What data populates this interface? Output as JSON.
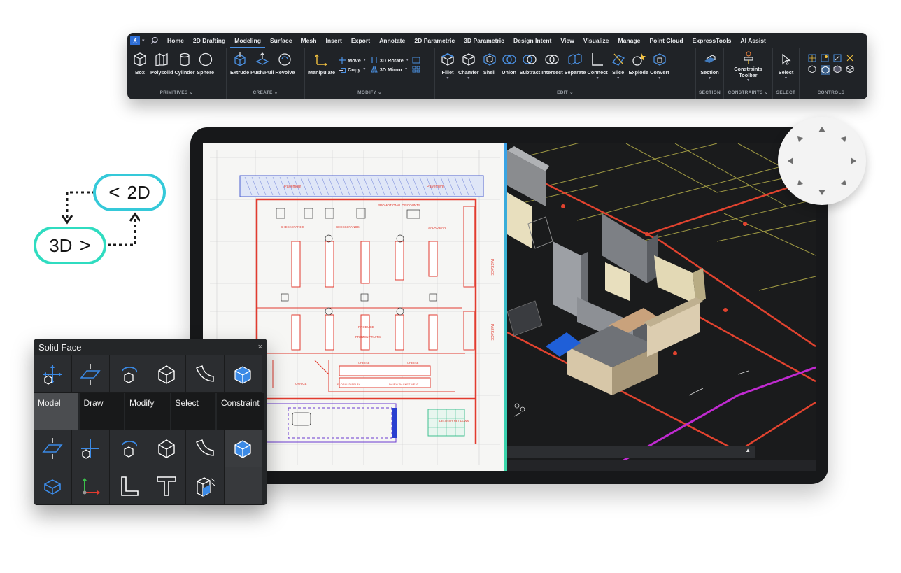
{
  "ribbon": {
    "tabs": [
      "Home",
      "2D Drafting",
      "Modeling",
      "Surface",
      "Mesh",
      "Insert",
      "Export",
      "Annotate",
      "2D Parametric",
      "3D Parametric",
      "Design Intent",
      "View",
      "Visualize",
      "Manage",
      "Point Cloud",
      "ExpressTools",
      "AI Assist"
    ],
    "active_tab": "Modeling",
    "primitives": {
      "tools": [
        "Box",
        "Polysolid",
        "Cylinder",
        "Sphere"
      ],
      "label": "PRIMITIVES ⌄"
    },
    "create": {
      "tools": [
        "Extrude",
        "Push/Pull",
        "Revolve"
      ],
      "label": "CREATE ⌄"
    },
    "modify": {
      "manipulate": "Manipulate",
      "move": "Move",
      "copy": "Copy",
      "rotate3d": "3D Rotate",
      "mirror3d": "3D Mirror",
      "label": "MODIFY ⌄"
    },
    "edit": {
      "tools": [
        "Fillet",
        "Chamfer",
        "Shell",
        "Union",
        "Subtract",
        "Intersect",
        "Separate",
        "Connect",
        "Slice",
        "Explode",
        "Convert"
      ],
      "label": "EDIT ⌄"
    },
    "section": {
      "tool": "Section",
      "label": "SECTION"
    },
    "constraints": {
      "tool_line1": "Constraints",
      "tool_line2": "Toolbar",
      "label": "CONSTRAINTS ⌄"
    },
    "select": {
      "tool": "Select",
      "label": "SELECT"
    },
    "controls": {
      "label": "CONTROLS"
    }
  },
  "switch": {
    "label_2d": "2D",
    "label_3d": "3D"
  },
  "floorplan": {
    "labels": [
      "Pavement",
      "Pavement",
      "PROMOTIONAL DISCOUNTS",
      "CHECKSTANDS",
      "CHECKSTANDS",
      "SALAD BAR",
      "PASSAGE",
      "PASSAGE",
      "PRODUCE",
      "FROZEN FRUITS",
      "OFFICE",
      "FLORAL DISPLAY",
      "DAIRY/ BACKET MEAT",
      "CHEESE",
      "CHEESE",
      "DELIVERY NET DOWN"
    ]
  },
  "solid_face": {
    "title": "Solid Face",
    "close": "×",
    "tabs": [
      "Model",
      "Draw",
      "Modify",
      "Select",
      "Constraint"
    ],
    "active_tab": "Model"
  },
  "colors": {
    "ribbon_bg": "#202327",
    "accent_blue": "#4a90e2",
    "pill_teal": "#2fdcc0",
    "plan_red": "#e23b2f"
  }
}
